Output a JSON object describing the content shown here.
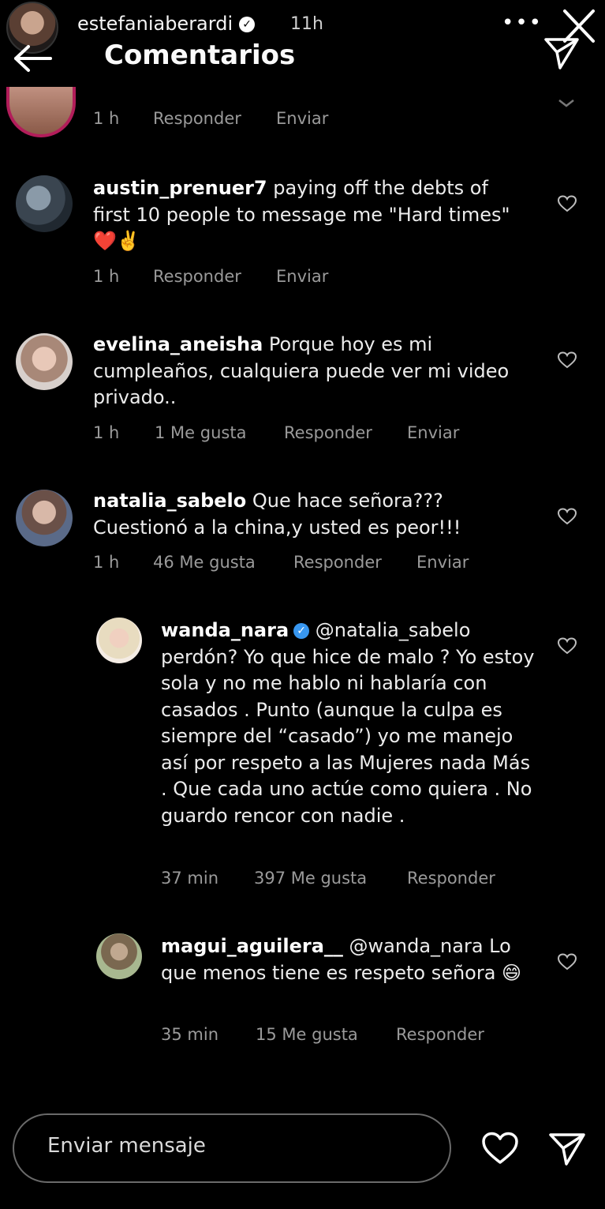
{
  "header": {
    "username": "estefaniaberardi",
    "time": "11h",
    "title": "Comentarios",
    "more_icon": "more-dots-icon",
    "close_icon": "close-icon",
    "back_icon": "back-arrow-icon",
    "send_icon": "send-icon"
  },
  "partial_comment": {
    "meta": {
      "time": "1 h",
      "reply": "Responder",
      "send": "Enviar"
    }
  },
  "comments": [
    {
      "username": "austin_prenuer7",
      "text": " paying off the debts of first  10 people to message  me \"Hard times\" ❤️✌️",
      "meta": {
        "time": "1 h",
        "reply": "Responder",
        "send": "Enviar"
      }
    },
    {
      "username": "evelina_aneisha",
      "text": " Porque hoy es mi cumpleaños, cualquiera puede ver mi video privado..",
      "meta": {
        "time": "1 h",
        "likes": "1 Me gusta",
        "reply": "Responder",
        "send": "Enviar"
      }
    },
    {
      "username": "natalia_sabelo",
      "text": " Que hace señora??? Cuestionó a la china,y usted es peor!!!",
      "meta": {
        "time": "1 h",
        "likes": "46 Me gusta",
        "reply": "Responder",
        "send": "Enviar"
      }
    }
  ],
  "replies": [
    {
      "username": "wanda_nara",
      "verified": true,
      "text": " @natalia_sabelo perdón? Yo que hice de malo ? Yo estoy sola y no me hablo ni hablaría con casados . Punto (aunque la culpa es siempre del “casado”) yo me manejo así por respeto a las Mujeres nada Más . Que cada uno actúe como quiera . No guardo rencor con nadie .",
      "meta": {
        "time": "37 min",
        "likes": "397 Me gusta",
        "reply": "Responder"
      }
    },
    {
      "username": "magui_aguilera__",
      "text": " @wanda_nara Lo que menos tiene es respeto señora 😄",
      "meta": {
        "time": "35 min",
        "likes": "15 Me gusta",
        "reply": "Responder"
      }
    }
  ],
  "footer": {
    "placeholder": "Enviar mensaje",
    "heart_icon": "heart-icon",
    "send_icon": "send-icon"
  },
  "colors": {
    "background": "#000000",
    "text": "#ffffff",
    "meta": "#9a9a9a"
  }
}
